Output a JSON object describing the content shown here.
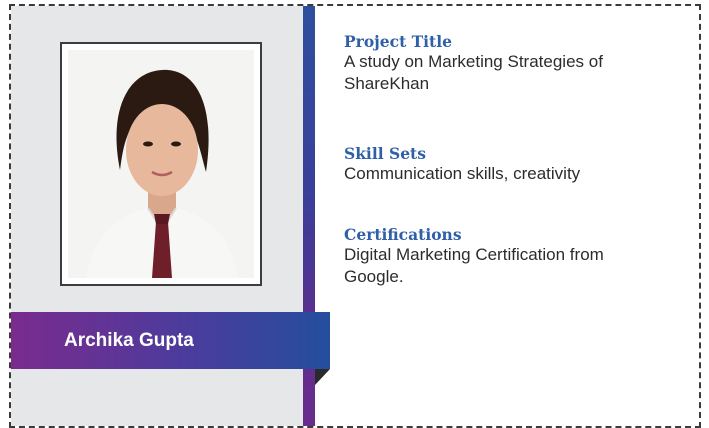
{
  "profile": {
    "name": "Archika Gupta",
    "photo_alt": "portrait-photo"
  },
  "details": [
    {
      "label": "Project Title",
      "value": "A study on Marketing Strategies of ShareKhan"
    },
    {
      "label": "Skill Sets",
      "value": "Communication skills, creativity"
    },
    {
      "label": "Certifications",
      "value": "Digital Marketing Certification from Google."
    }
  ],
  "colors": {
    "label_blue": "#2f5fa8",
    "banner_start": "#7a2b8e",
    "banner_end": "#244e9d",
    "panel_grey": "#e6e7e8"
  }
}
